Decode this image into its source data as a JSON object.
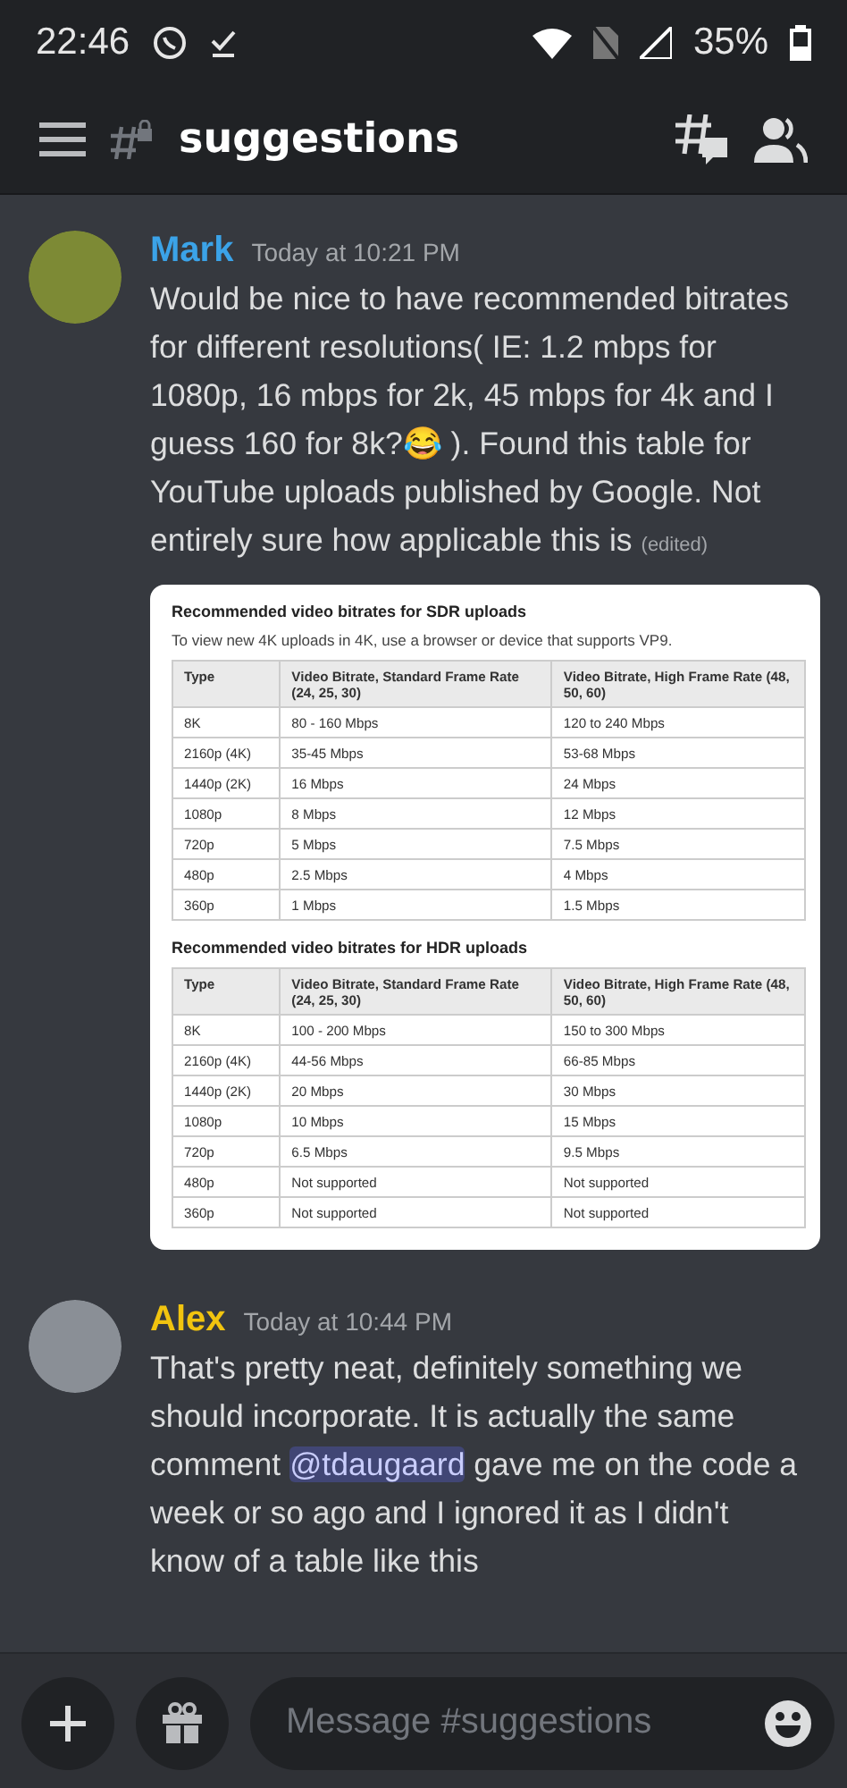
{
  "status_bar": {
    "time": "22:46",
    "battery": "35%"
  },
  "header": {
    "channel": "suggestions"
  },
  "messages": [
    {
      "author": "Mark",
      "color": "#3ba3e8",
      "timestamp": "Today at 10:21 PM",
      "text": "Would be nice to have recommended bitrates for different resolutions( IE: 1.2 mbps for 1080p, 16 mbps for 2k, 45 mbps for 4k and I guess 160 for 8k?😂 ). Found this table for YouTube uploads published by Google. Not entirely sure how applicable this is",
      "edited": "(edited)",
      "attachment": {
        "tables": [
          {
            "title": "Recommended video bitrates for SDR uploads",
            "subtitle": "To view new 4K uploads in 4K, use a browser or device that supports VP9.",
            "columns": [
              "Type",
              "Video Bitrate, Standard Frame Rate (24, 25, 30)",
              "Video Bitrate, High Frame Rate (48, 50, 60)"
            ],
            "rows": [
              [
                "8K",
                "80 - 160 Mbps",
                "120 to 240 Mbps"
              ],
              [
                "2160p (4K)",
                "35-45 Mbps",
                "53-68 Mbps"
              ],
              [
                "1440p (2K)",
                "16 Mbps",
                "24 Mbps"
              ],
              [
                "1080p",
                "8 Mbps",
                "12 Mbps"
              ],
              [
                "720p",
                "5 Mbps",
                "7.5 Mbps"
              ],
              [
                "480p",
                "2.5 Mbps",
                "4 Mbps"
              ],
              [
                "360p",
                "1 Mbps",
                "1.5 Mbps"
              ]
            ]
          },
          {
            "title": "Recommended video bitrates for HDR uploads",
            "columns": [
              "Type",
              "Video Bitrate, Standard Frame Rate (24, 25, 30)",
              "Video Bitrate, High Frame Rate (48, 50, 60)"
            ],
            "rows": [
              [
                "8K",
                "100 - 200 Mbps",
                "150 to 300 Mbps"
              ],
              [
                "2160p (4K)",
                "44-56 Mbps",
                "66-85 Mbps"
              ],
              [
                "1440p (2K)",
                "20 Mbps",
                "30 Mbps"
              ],
              [
                "1080p",
                "10 Mbps",
                "15 Mbps"
              ],
              [
                "720p",
                "6.5 Mbps",
                "9.5 Mbps"
              ],
              [
                "480p",
                "Not supported",
                "Not supported"
              ],
              [
                "360p",
                "Not supported",
                "Not supported"
              ]
            ]
          }
        ]
      }
    },
    {
      "author": "Alex",
      "color": "#f1c40f",
      "timestamp": "Today at 10:44 PM",
      "text_before_mention": "That's pretty neat, definitely something we should incorporate. It is actually the same comment",
      "mention": "@tdaugaard",
      "text_after_mention": "gave me on the code a week or so ago and I ignored it as I didn't know of a table like this"
    }
  ],
  "composer": {
    "placeholder": "Message #suggestions"
  }
}
